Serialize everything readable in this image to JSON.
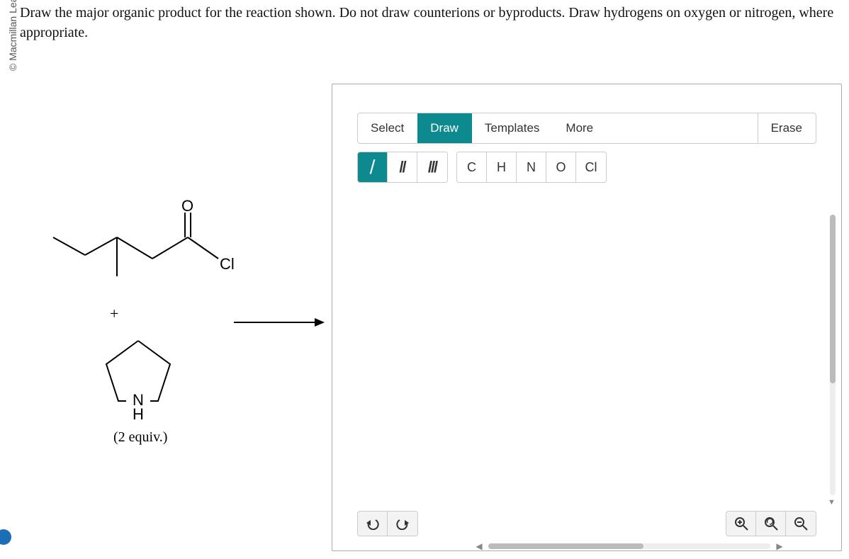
{
  "copyright": "© Macmillan Learning",
  "prompt": "Draw the major organic product for the reaction shown. Do not draw counterions or byproducts. Draw hydrogens on oxygen or nitrogen, where appropriate.",
  "reagents": {
    "plus": "+",
    "atom_O": "O",
    "atom_Cl": "Cl",
    "atom_N": "N",
    "atom_H": "H",
    "equiv": "(2 equiv.)"
  },
  "editor": {
    "tabs": {
      "select": "Select",
      "draw": "Draw",
      "templates": "Templates",
      "more": "More",
      "erase": "Erase"
    },
    "bonds": {
      "single": "/",
      "double": "//",
      "triple": "///"
    },
    "elements": {
      "C": "C",
      "H": "H",
      "N": "N",
      "O": "O",
      "Cl": "Cl"
    }
  }
}
